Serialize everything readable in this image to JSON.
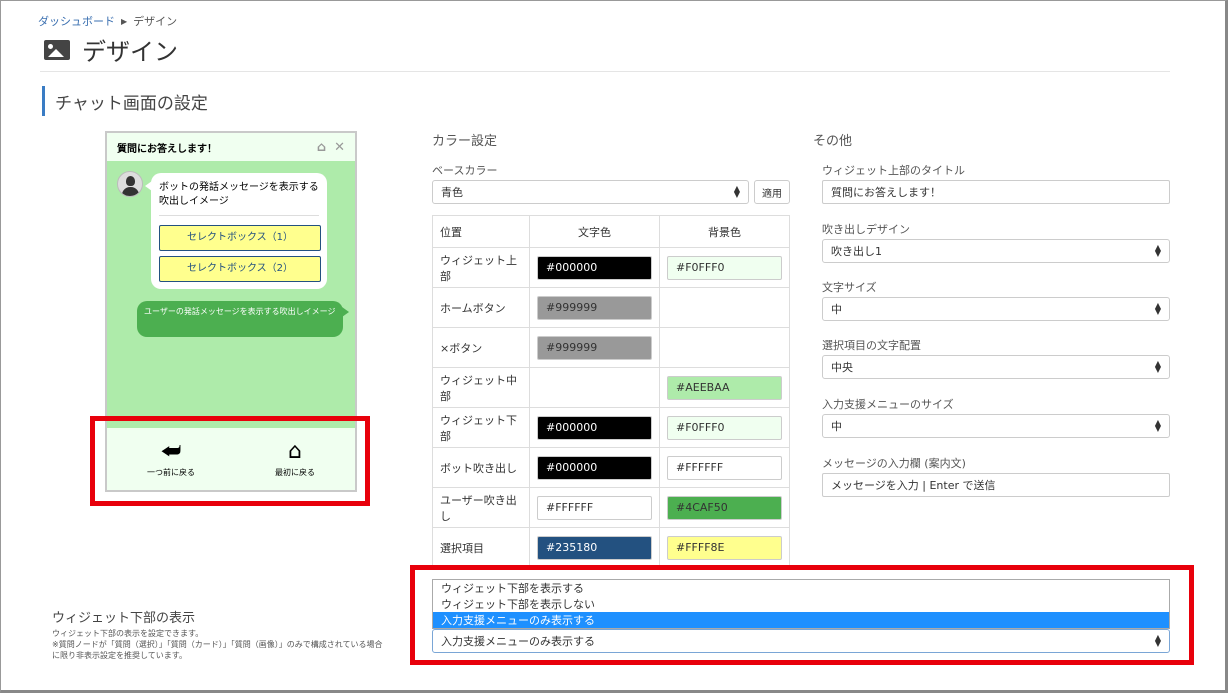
{
  "breadcrumb": {
    "home": "ダッシュボード",
    "current": "デザイン"
  },
  "page": {
    "title": "デザイン"
  },
  "section": {
    "title": "チャット画面の設定"
  },
  "preview": {
    "header_title": "質問にお答えします！",
    "bot_message": "ボットの発話メッセージを表示する吹出しイメージ",
    "options": [
      "セレクトボックス（1）",
      "セレクトボックス（2）"
    ],
    "user_message": "ユーザーの発話メッセージを表示する吹出しイメージ",
    "footer": {
      "back_label": "一つ前に戻る",
      "home_label": "最初に戻る"
    }
  },
  "color_settings": {
    "heading": "カラー設定",
    "base_color_label": "ベースカラー",
    "base_color_value": "青色",
    "apply_label": "適用",
    "table": {
      "headers": [
        "位置",
        "文字色",
        "背景色"
      ],
      "rows": [
        {
          "name": "ウィジェット上部",
          "text": "#000000",
          "text_bg": "#000000",
          "text_fg": "#ffffff",
          "bg": "#F0FFF0",
          "bg_bg": "#F0FFF0",
          "bg_fg": "#333333"
        },
        {
          "name": "ホームボタン",
          "text": "#999999",
          "text_bg": "#999999",
          "text_fg": "#333333",
          "bg": "",
          "bg_bg": "",
          "bg_fg": ""
        },
        {
          "name": "×ボタン",
          "text": "#999999",
          "text_bg": "#999999",
          "text_fg": "#333333",
          "bg": "",
          "bg_bg": "",
          "bg_fg": ""
        },
        {
          "name": "ウィジェット中部",
          "text": "",
          "text_bg": "",
          "text_fg": "",
          "bg": "#AEEBAA",
          "bg_bg": "#AEEBAA",
          "bg_fg": "#333333"
        },
        {
          "name": "ウィジェット下部",
          "text": "#000000",
          "text_bg": "#000000",
          "text_fg": "#ffffff",
          "bg": "#F0FFF0",
          "bg_bg": "#F0FFF0",
          "bg_fg": "#333333"
        },
        {
          "name": "ボット吹き出し",
          "text": "#000000",
          "text_bg": "#000000",
          "text_fg": "#ffffff",
          "bg": "#FFFFFF",
          "bg_bg": "#FFFFFF",
          "bg_fg": "#333333"
        },
        {
          "name": "ユーザー吹き出し",
          "text": "#FFFFFF",
          "text_bg": "#FFFFFF",
          "text_fg": "#333333",
          "bg": "#4CAF50",
          "bg_bg": "#4CAF50",
          "bg_fg": "#333333"
        },
        {
          "name": "選択項目",
          "text": "#235180",
          "text_bg": "#235180",
          "text_fg": "#ffffff",
          "bg": "#FFFF8E",
          "bg_bg": "#FFFF8E",
          "bg_fg": "#333333"
        }
      ]
    }
  },
  "other": {
    "heading": "その他",
    "widget_title_label": "ウィジェット上部のタイトル",
    "widget_title_value": "質問にお答えします！",
    "bubble_design_label": "吹き出しデザイン",
    "bubble_design_value": "吹き出し1",
    "font_size_label": "文字サイズ",
    "font_size_value": "中",
    "alignment_label": "選択項目の文字配置",
    "alignment_value": "中央",
    "menu_size_label": "入力支援メニューのサイズ",
    "menu_size_value": "中",
    "placeholder_label": "メッセージの入力欄 (案内文)",
    "placeholder_value": "メッセージを入力 | Enter で送信"
  },
  "widget_footer": {
    "heading": "ウィジェット下部の表示",
    "desc_line1": "ウィジェット下部の表示を設定できます。",
    "desc_line2": "※質問ノードが「質問（選択）」「質問（カード）」「質問（画像）」のみで構成されている場合",
    "desc_line3": "に限り非表示設定を推奨しています。",
    "options": [
      "ウィジェット下部を表示する",
      "ウィジェット下部を表示しない",
      "入力支援メニューのみ表示する"
    ],
    "selected": "入力支援メニューのみ表示する"
  },
  "colors": {
    "accent": "#3a7cc4",
    "highlight_red": "#e8000b",
    "dropdown_selected": "#1e90ff"
  }
}
